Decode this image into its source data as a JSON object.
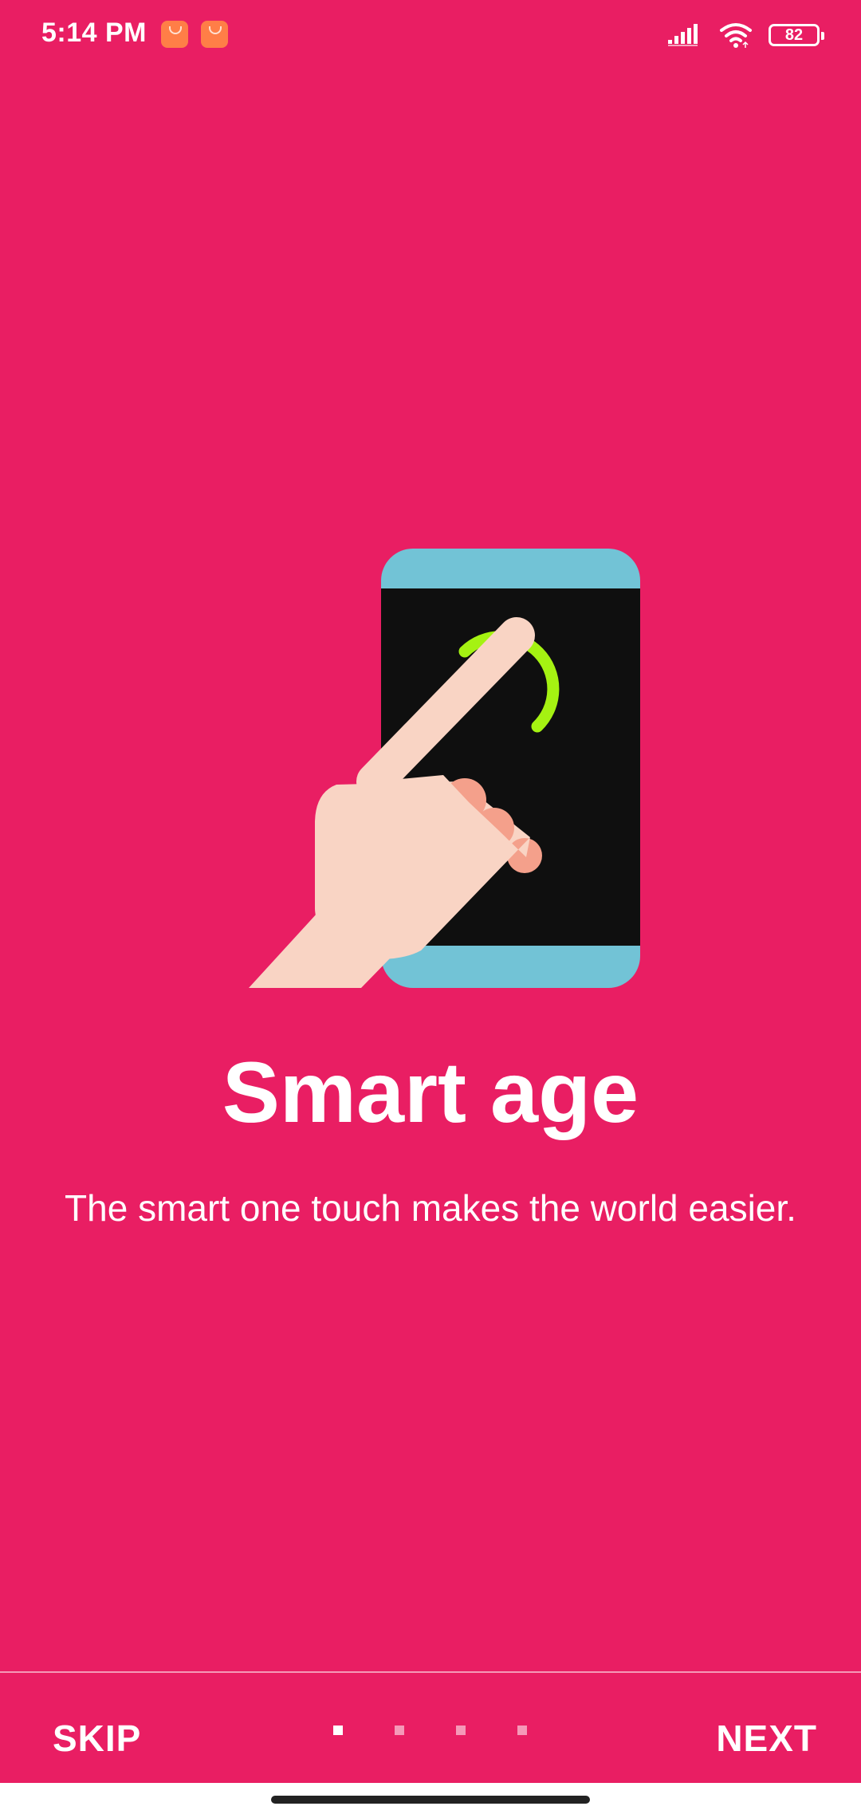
{
  "status_bar": {
    "time": "5:14 PM",
    "battery_level": "82",
    "notification_icons": [
      "shop-app-icon",
      "shop-app-icon"
    ],
    "signal_icon": "cellular-signal-icon",
    "wifi_icon": "wifi-icon"
  },
  "onboarding": {
    "illustration_icon": "phone-touch-illustration",
    "title": "Smart age",
    "subtitle": "The smart one touch makes the world easier.",
    "page_index": 1,
    "page_count": 4
  },
  "footer": {
    "skip_label": "SKIP",
    "next_label": "NEXT"
  },
  "colors": {
    "background": "#E91E63",
    "phone_frame": "#72C3D6",
    "phone_screen": "#0F0F0F",
    "touch_ring": "#A5F212",
    "hand": "#F9D4C4",
    "knuckles": "#F4A08B"
  }
}
